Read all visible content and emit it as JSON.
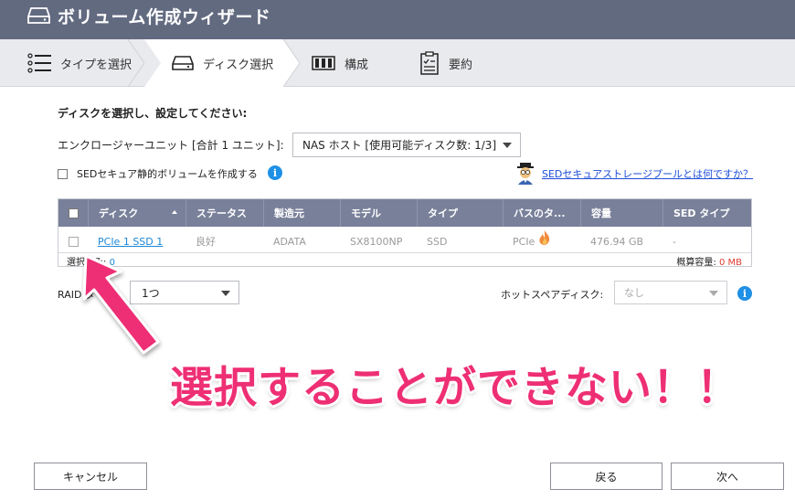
{
  "window": {
    "title": "ボリューム作成ウィザード"
  },
  "steps": [
    {
      "label": "タイプを選択",
      "icon": "list-icon"
    },
    {
      "label": "ディスク選択",
      "icon": "disk-icon"
    },
    {
      "label": "構成",
      "icon": "raid-icon"
    },
    {
      "label": "要約",
      "icon": "summary-icon"
    }
  ],
  "form": {
    "instruction": "ディスクを選択し、設定してください:",
    "enclosure_label": "エンクロージャーユニット [合計 1 ユニット]:",
    "enclosure_value": "NAS ホスト [使用可能ディスク数: 1/3]",
    "sed_checkbox_label": "SEDセキュア静的ボリュームを作成する",
    "sed_link": "SEDセキュアストレージプールとは何ですか？"
  },
  "table": {
    "headers": [
      "ディスク",
      "ステータス",
      "製造元",
      "モデル",
      "タイプ",
      "バスのタ...",
      "容量",
      "SED タイプ"
    ],
    "rows": [
      {
        "disk": "PCIe 1 SSD 1",
        "status": "良好",
        "vendor": "ADATA",
        "model": "SX8100NP",
        "type": "SSD",
        "bus": "PCIe",
        "capacity": "476.94 GB",
        "sed": "-"
      }
    ],
    "footer_selected_prefix": "選択済み: ",
    "footer_selected_count": "0",
    "footer_capacity_prefix": "概算容量: ",
    "footer_capacity_value": "0 MB"
  },
  "raid": {
    "label": "RAID タ",
    "value": "1つ"
  },
  "hotspare": {
    "label": "ホットスペアディスク:",
    "value": "なし"
  },
  "annotation": {
    "text": "選択することができない！！",
    "color": "#ee2f74"
  },
  "buttons": {
    "cancel": "キャンセル",
    "back": "戻る",
    "next": "次へ"
  },
  "colors": {
    "titlebar": "#626a80",
    "table_header": "#79809a",
    "link": "#1e88d8",
    "info": "#1e90e6"
  }
}
